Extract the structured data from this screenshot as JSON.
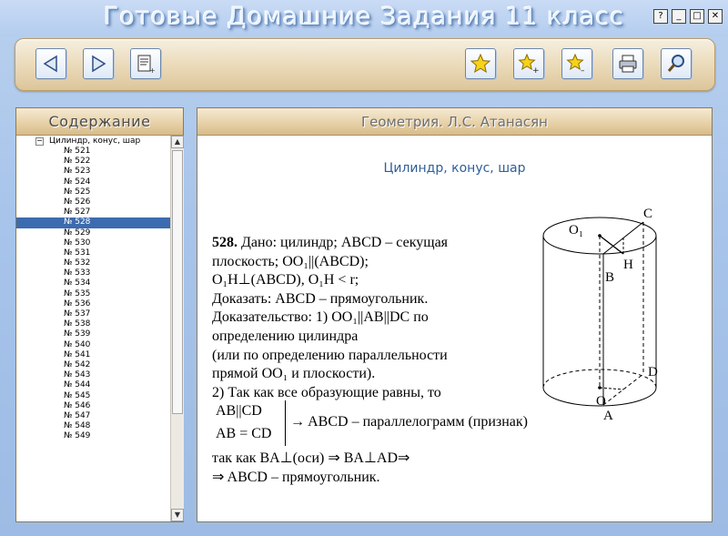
{
  "window": {
    "title": "Готовые Домашние Задания 11 класс",
    "buttons": [
      "?",
      "_",
      "□",
      "✕"
    ]
  },
  "toolbar": {
    "buttons": [
      "back-icon",
      "forward-icon",
      "notes-icon",
      "bookmark-star-icon",
      "add-bookmark-icon",
      "remove-bookmark-icon",
      "print-icon",
      "search-icon"
    ]
  },
  "sidebar": {
    "title": "Содержание",
    "root": "Цилиндр, конус, шар",
    "items": [
      "№ 521",
      "№ 522",
      "№ 523",
      "№ 524",
      "№ 525",
      "№ 526",
      "№ 527",
      "№ 528",
      "№ 529",
      "№ 530",
      "№ 531",
      "№ 532",
      "№ 533",
      "№ 534",
      "№ 535",
      "№ 536",
      "№ 537",
      "№ 538",
      "№ 539",
      "№ 540",
      "№ 541",
      "№ 542",
      "№ 543",
      "№ 544",
      "№ 545",
      "№ 546",
      "№ 547",
      "№ 548",
      "№ 549"
    ],
    "selected": "№ 528"
  },
  "content": {
    "header": "Геометрия. Л.С. Атанасян",
    "section_title": "Цилиндр, конус, шар",
    "problem_number": "528.",
    "lines": [
      "Дано: цилиндр; ABCD – секущая",
      "плоскость; OO₁||(ABCD);",
      "O₁H⊥(ABCD), O₁H < r;",
      "Доказать: ABCD – прямоугольник.",
      "Доказательство: 1) OO₁||AB||DC по",
      "определению цилиндра",
      "(или по определению параллельности",
      "прямой OO₁ и плоскости).",
      "2)  Так как все образующие равны, то"
    ],
    "system_line1": "AB||CD",
    "system_line2": "AB = CD",
    "system_result": "→ ABCD – параллелограмм (признак)",
    "tail_lines": [
      "так как BA⊥(оси) ⇒ BA⊥AD⇒",
      "⇒ ABCD – прямоугольник."
    ],
    "figure_labels": {
      "o1": "O₁",
      "c": "C",
      "h": "H",
      "b": "B",
      "d": "D",
      "o": "O",
      "a": "A"
    }
  }
}
